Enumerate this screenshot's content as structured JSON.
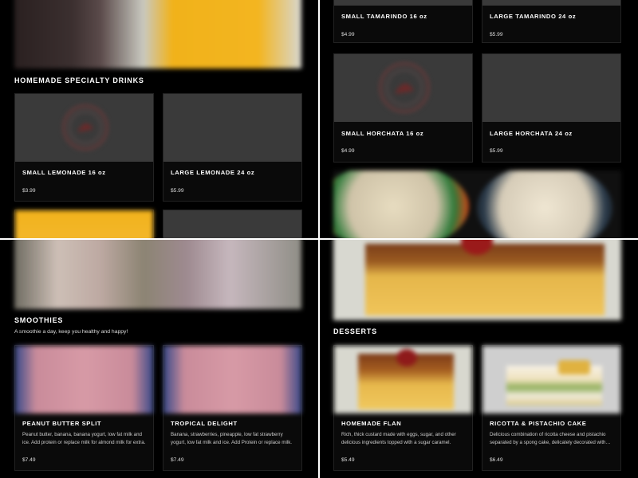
{
  "drinks": {
    "title": "HOMEMADE SPECIALTY DRINKS",
    "items": [
      {
        "name": "SMALL LEMONADE 16 oz",
        "price": "$3.99"
      },
      {
        "name": "LARGE LEMONADE 24 oz",
        "price": "$5.99"
      },
      {
        "name": "SMALL TAMARINDO 16 oz",
        "price": "$4.99"
      },
      {
        "name": "LARGE TAMARINDO 24 oz",
        "price": "$5.99"
      },
      {
        "name": "SMALL HORCHATA 16 oz",
        "price": "$4.99"
      },
      {
        "name": "LARGE HORCHATA 24 oz",
        "price": "$5.99"
      }
    ]
  },
  "smoothies": {
    "title": "SMOOTHIES",
    "subtitle": "A smoothie a day, keep you healthy and happy!",
    "items": [
      {
        "name": "PEANUT BUTTER SPLIT",
        "desc": "Peanut butter, banana, banana yogurt, low fat milk and ice. Add protein or replace milk for almond milk for extra.",
        "price": "$7.49"
      },
      {
        "name": "TROPICAL DELIGHT",
        "desc": "Banana, strawberries, pineapple, low fat strawberry yogurt, low fat milk and ice. Add Protein or replace milk.",
        "price": "$7.49"
      }
    ]
  },
  "desserts": {
    "title": "DESSERTS",
    "items": [
      {
        "name": "HOMEMADE FLAN",
        "desc": "Rich, thick custard made with eggs, sugar, and other delicious ingredients topped with a sugar caramel.",
        "price": "$5.49"
      },
      {
        "name": "RICOTTA & PISTACHIO CAKE",
        "desc": "Delicious combination of ricotta cheese and pistachio separated by a spong cake, delicately decorated with chopped pistachios.",
        "price": "$6.49"
      }
    ]
  },
  "colors": {
    "background": "#000000",
    "card": "#0a0a0a",
    "placeholder": "#3a3a3a",
    "text": "#ffffff"
  },
  "icons": [
    "restaurant-logo-icon"
  ]
}
